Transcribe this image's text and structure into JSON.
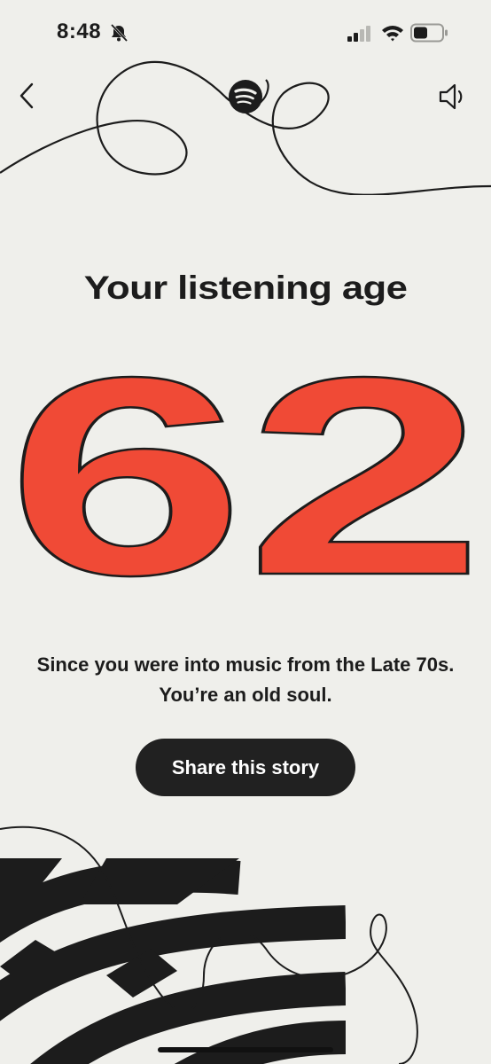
{
  "status_bar": {
    "time": "8:48",
    "icons": [
      "bell-slash-icon",
      "cellular-signal-icon",
      "wifi-icon",
      "battery-icon"
    ]
  },
  "header": {
    "back_icon": "chevron-left-icon",
    "logo_icon": "spotify-logo-icon",
    "sound_icon": "speaker-icon"
  },
  "story": {
    "headline": "Your listening age",
    "age": "62",
    "description": "Since you were into music from the Late 70s. You’re an old soul.",
    "share_label": "Share this story"
  },
  "colors": {
    "background": "#efefeb",
    "age_number": "#f04a36",
    "outline": "#1c1c1c",
    "button": "#212121",
    "button_text": "#ffffff"
  }
}
